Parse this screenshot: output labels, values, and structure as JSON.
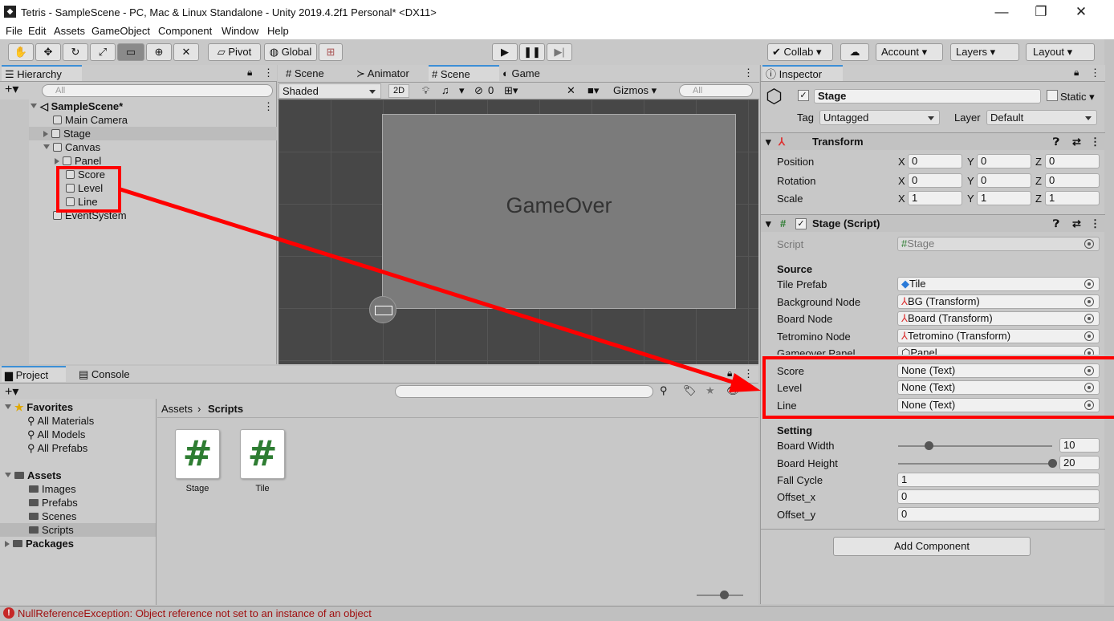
{
  "window": {
    "title": "Tetris - SampleScene - PC, Mac & Linux Standalone - Unity 2019.4.2f1 Personal* <DX11>",
    "minimize": "—",
    "maximize": "❐",
    "close": "✕"
  },
  "menu": [
    "File",
    "Edit",
    "Assets",
    "GameObject",
    "Component",
    "Window",
    "Help"
  ],
  "toolbar": {
    "pivot": "Pivot",
    "global": "Global",
    "collab": "Collab",
    "account": "Account",
    "layers": "Layers",
    "layout": "Layout"
  },
  "hierarchy": {
    "tab": "Hierarchy",
    "search_placeholder": "All",
    "scene": "SampleScene*",
    "items": [
      "Main Camera",
      "Stage",
      "Canvas",
      "Panel",
      "Score",
      "Level",
      "Line",
      "EventSystem"
    ]
  },
  "scene": {
    "tabs": [
      "Scene",
      "Animator",
      "Scene",
      "Game"
    ],
    "shading": "Shaded",
    "mode2d": "2D",
    "gizmos": "Gizmos",
    "search_placeholder": "All",
    "hidden_count": "0",
    "game_over_text": "GameOver"
  },
  "project": {
    "tabs": [
      "Project",
      "Console"
    ],
    "favorites_label": "Favorites",
    "favorites": [
      "All Materials",
      "All Models",
      "All Prefabs"
    ],
    "assets_label": "Assets",
    "assets": [
      "Images",
      "Prefabs",
      "Scenes",
      "Scripts"
    ],
    "packages_label": "Packages",
    "breadcrumb": [
      "Assets",
      "Scripts"
    ],
    "files": [
      "Stage",
      "Tile"
    ],
    "script_glyph": "#"
  },
  "inspector": {
    "tab": "Inspector",
    "object_name": "Stage",
    "static_label": "Static",
    "tag_label": "Tag",
    "tag_value": "Untagged",
    "layer_label": "Layer",
    "layer_value": "Default",
    "transform": {
      "title": "Transform",
      "rows": [
        {
          "label": "Position",
          "x": "0",
          "y": "0",
          "z": "0"
        },
        {
          "label": "Rotation",
          "x": "0",
          "y": "0",
          "z": "0"
        },
        {
          "label": "Scale",
          "x": "1",
          "y": "1",
          "z": "1"
        }
      ]
    },
    "script_comp": {
      "title": "Stage (Script)",
      "script_label": "Script",
      "script_value": "Stage",
      "source_header": "Source",
      "source_fields": [
        {
          "label": "Tile Prefab",
          "value": "Tile"
        },
        {
          "label": "Background Node",
          "value": "BG (Transform)"
        },
        {
          "label": "Board Node",
          "value": "Board (Transform)"
        },
        {
          "label": "Tetromino Node",
          "value": "Tetromino (Transform)"
        },
        {
          "label": "Gameover Panel",
          "value": "Panel"
        },
        {
          "label": "Score",
          "value": "None (Text)"
        },
        {
          "label": "Level",
          "value": "None (Text)"
        },
        {
          "label": "Line",
          "value": "None (Text)"
        }
      ],
      "setting_header": "Setting",
      "board_width_label": "Board Width",
      "board_width": "10",
      "board_height_label": "Board Height",
      "board_height": "20",
      "board_width_fraction": 0.2,
      "board_height_fraction": 1.0,
      "fall_cycle_label": "Fall Cycle",
      "fall_cycle": "1",
      "offset_x_label": "Offset_x",
      "offset_x": "0",
      "offset_y_label": "Offset_y",
      "offset_y": "0"
    },
    "add_component": "Add Component"
  },
  "status": {
    "error": "NullReferenceException: Object reference not set to an instance of an object"
  },
  "colors": {
    "highlight_red": "#ff0000",
    "accent_blue": "#3c8fd6"
  }
}
